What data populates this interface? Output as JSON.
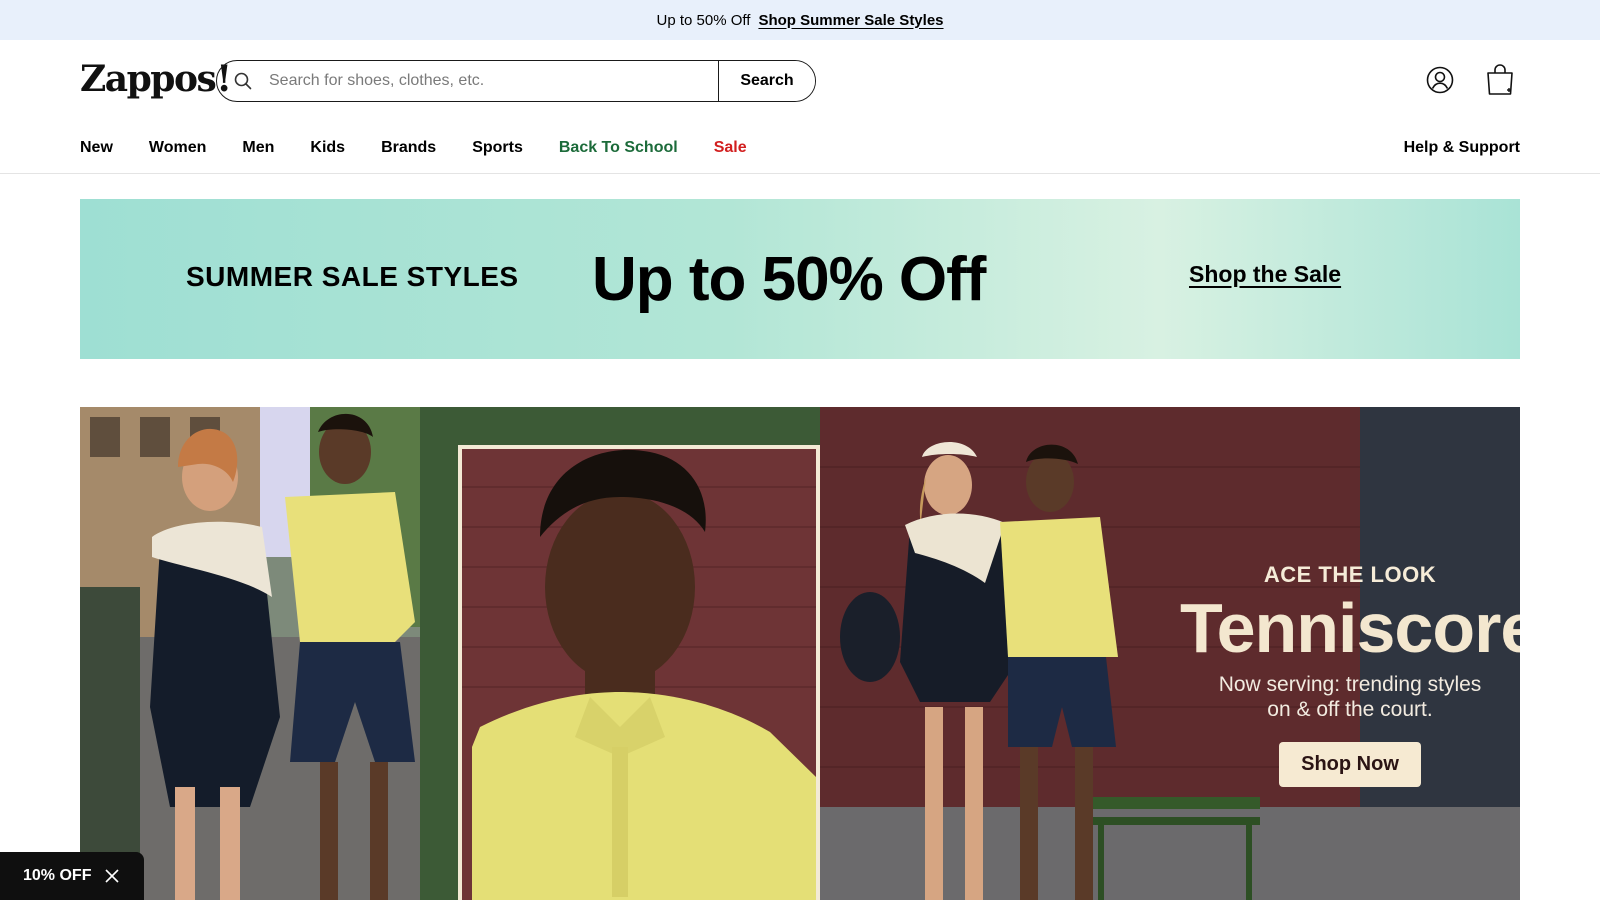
{
  "promo_strip": {
    "text": "Up to 50% Off",
    "link": "Shop Summer Sale Styles"
  },
  "header": {
    "logo": "Zappos",
    "logo_mark": "!",
    "search": {
      "placeholder": "Search for shoes, clothes, etc.",
      "value": "",
      "button": "Search"
    },
    "icons": [
      "search-icon",
      "account-icon",
      "cart-icon"
    ]
  },
  "nav": {
    "items": [
      {
        "label": "New"
      },
      {
        "label": "Women"
      },
      {
        "label": "Men"
      },
      {
        "label": "Kids"
      },
      {
        "label": "Brands"
      },
      {
        "label": "Sports"
      },
      {
        "label": "Back To School",
        "color": "#1c6b3a"
      },
      {
        "label": "Sale",
        "color": "#d21f1f"
      }
    ],
    "help": "Help & Support"
  },
  "sale_banner": {
    "left": "SUMMER SALE STYLES",
    "headline": "Up to 50% Off",
    "link": "Shop the Sale"
  },
  "hero": {
    "eyebrow": "ACE THE LOOK",
    "headline": "Tenniscore",
    "sub_line1": "Now serving: trending styles",
    "sub_line2": "on & off the court.",
    "cta": "Shop Now"
  },
  "discount_tab": {
    "label": "10% OFF",
    "close_icon": "close-icon"
  },
  "colors": {
    "promo_bg": "#e8f0fb",
    "banner_teal": "#9edfd3",
    "accent_green": "#1c6b3a",
    "accent_red": "#d21f1f",
    "hero_cta_bg": "#f6ead2"
  }
}
